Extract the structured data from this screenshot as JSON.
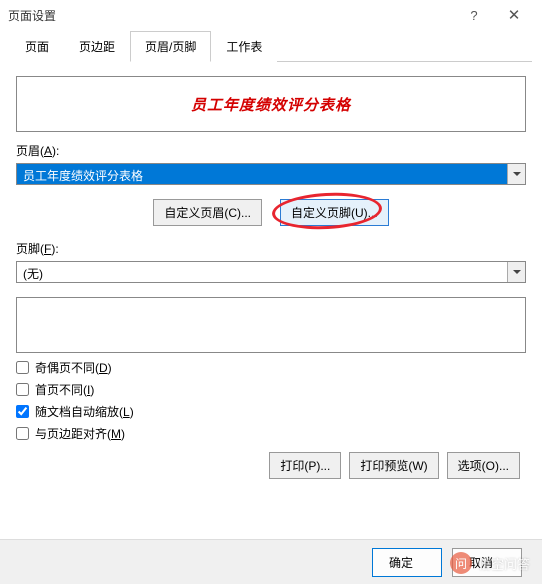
{
  "titlebar": {
    "title": "页面设置"
  },
  "tabs": {
    "page": "页面",
    "margin": "页边距",
    "header_footer": "页眉/页脚",
    "sheet": "工作表"
  },
  "header_preview": "员工年度绩效评分表格",
  "header": {
    "label_prefix": "页眉(",
    "label_key": "A",
    "label_suffix": "):",
    "value": "员工年度绩效评分表格"
  },
  "buttons": {
    "custom_header": "自定义页眉(C)...",
    "custom_footer": "自定义页脚(U)..."
  },
  "footer": {
    "label_prefix": "页脚(",
    "label_key": "F",
    "label_suffix": "):",
    "value": "(无)"
  },
  "checks": {
    "odd_even": {
      "label_prefix": "奇偶页不同(",
      "label_key": "D",
      "label_suffix": ")",
      "checked": false
    },
    "first_page": {
      "label_prefix": "首页不同(",
      "label_key": "I",
      "label_suffix": ")",
      "checked": false
    },
    "scale_with_doc": {
      "label_prefix": "随文档自动缩放(",
      "label_key": "L",
      "label_suffix": ")",
      "checked": true
    },
    "align_margins": {
      "label_prefix": "与页边距对齐(",
      "label_key": "M",
      "label_suffix": ")",
      "checked": false
    }
  },
  "actions": {
    "print": "打印(P)...",
    "preview": "打印预览(W)",
    "options": "选项(O)..."
  },
  "dialog": {
    "ok": "确定",
    "cancel": "取消"
  },
  "watermark": {
    "icon": "问",
    "text": "悟空问答"
  }
}
